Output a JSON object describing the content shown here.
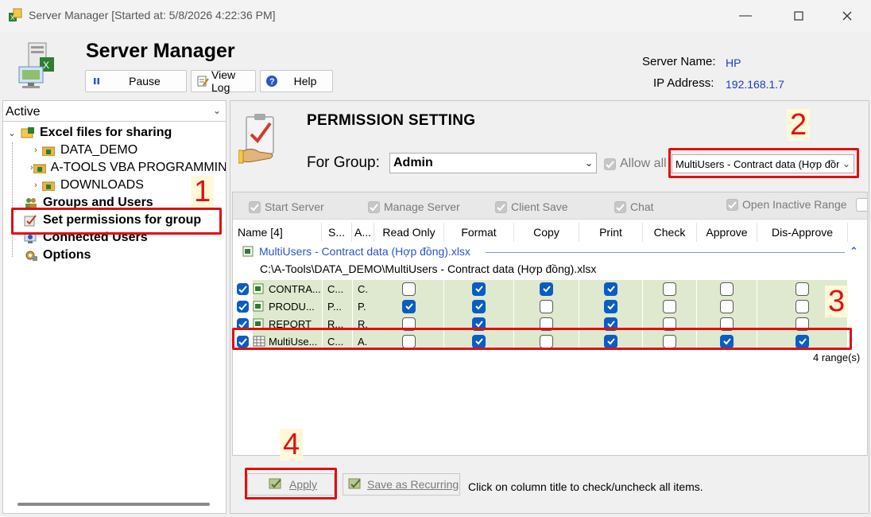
{
  "window": {
    "title": "Server Manager [Started at: 5/8/2026 4:22:36 PM]"
  },
  "header": {
    "app_title": "Server Manager",
    "buttons": {
      "pause": "Pause",
      "view_log": "View Log",
      "help": "Help"
    },
    "server_name_label": "Server Name:",
    "server_name": "HP",
    "ip_label": "IP Address:",
    "ip": "192.168.1.7"
  },
  "left": {
    "dropdown": "Active",
    "tree": {
      "excel_files": "Excel files for sharing",
      "folders": [
        "DATA_DEMO",
        "A-TOOLS VBA PROGRAMMING",
        "DOWNLOADS"
      ],
      "groups_users": "Groups and Users",
      "set_permissions": "Set permissions for group",
      "connected_users": "Connected Users",
      "options": "Options"
    }
  },
  "right": {
    "title": "PERMISSION SETTING",
    "for_group_label": "For Group:",
    "group_value": "Admin",
    "allow_all": "Allow all",
    "file_value": "MultiUsers - Contract data (Hợp đồng).xlsx",
    "perms": [
      "Start Server",
      "Manage Server",
      "Client Save",
      "Chat",
      "Open Inactive Range"
    ],
    "columns": [
      "Name [4]",
      "S...",
      "A...",
      "Read Only",
      "Format",
      "Copy",
      "Print",
      "Check",
      "Approve",
      "Dis-Approve"
    ],
    "file_group": {
      "name": "MultiUsers - Contract data (Hợp đồng).xlsx",
      "path": "C:\\A-Tools\\DATA_DEMO\\MultiUsers - Contract data (Hợp đồng).xlsx"
    },
    "rows": [
      {
        "name": "CONTRA...",
        "s": "C...",
        "a": "C.",
        "icon": "excel-sheet-icon",
        "flags": [
          false,
          true,
          true,
          true,
          false,
          false,
          false
        ]
      },
      {
        "name": "PRODU...",
        "s": "P...",
        "a": "P.",
        "icon": "excel-sheet-icon",
        "flags": [
          true,
          true,
          false,
          true,
          false,
          false,
          false
        ]
      },
      {
        "name": "REPORT",
        "s": "R...",
        "a": "R.",
        "icon": "excel-sheet-icon",
        "flags": [
          false,
          true,
          false,
          true,
          false,
          false,
          false
        ]
      },
      {
        "name": "MultiUse...",
        "s": "C...",
        "a": "A.",
        "icon": "range-grid-icon",
        "flags": [
          false,
          true,
          false,
          true,
          false,
          true,
          true
        ]
      }
    ],
    "range_count": "4 range(s)",
    "apply": "Apply",
    "save_recurring": "Save as Recurring",
    "hint": "Click on column title to check/uncheck all items."
  },
  "callouts": [
    "1",
    "2",
    "3",
    "4"
  ],
  "colors": {
    "accent": "#0b5cc4",
    "callout": "#e01010",
    "row_fill": "#dfe9cf",
    "link": "#1a3ccf"
  }
}
